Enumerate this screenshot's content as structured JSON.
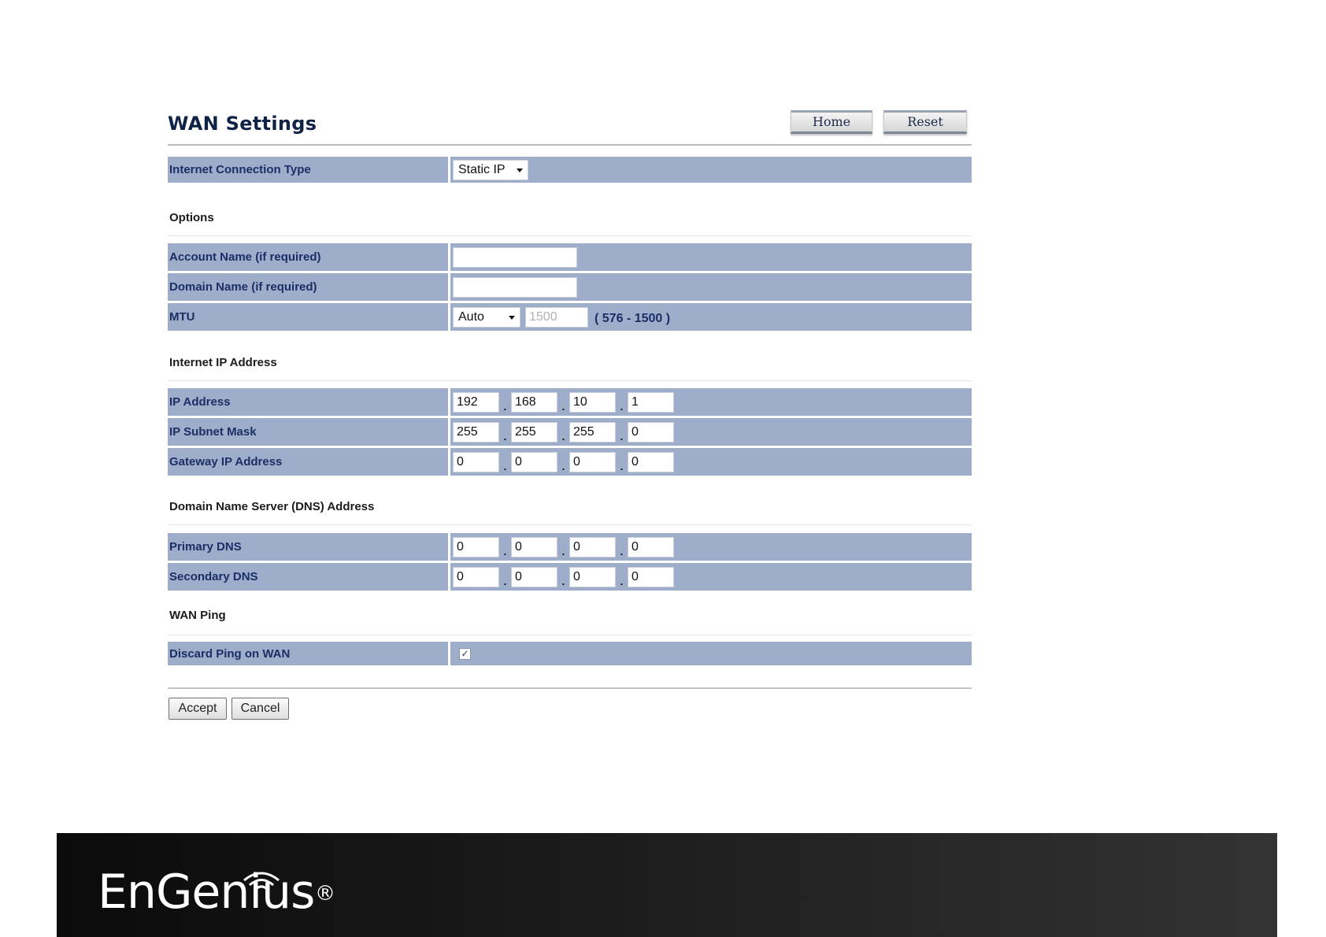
{
  "header": {
    "title": "WAN Settings",
    "home_label": "Home",
    "reset_label": "Reset"
  },
  "connection": {
    "label": "Internet Connection Type",
    "value": "Static IP"
  },
  "options": {
    "heading": "Options",
    "account_label": "Account Name (if required)",
    "account_value": "",
    "domain_label": "Domain Name (if required)",
    "domain_value": "",
    "mtu_label": "MTU",
    "mtu_mode": "Auto",
    "mtu_value": "1500",
    "mtu_range": "( 576 - 1500 )"
  },
  "internet_ip": {
    "heading": "Internet IP Address",
    "ip_label": "IP Address",
    "ip": [
      "192",
      "168",
      "10",
      "1"
    ],
    "mask_label": "IP Subnet Mask",
    "mask": [
      "255",
      "255",
      "255",
      "0"
    ],
    "gateway_label": "Gateway IP Address",
    "gateway": [
      "0",
      "0",
      "0",
      "0"
    ]
  },
  "dns": {
    "heading": "Domain Name Server (DNS) Address",
    "primary_label": "Primary DNS",
    "primary": [
      "0",
      "0",
      "0",
      "0"
    ],
    "secondary_label": "Secondary DNS",
    "secondary": [
      "0",
      "0",
      "0",
      "0"
    ]
  },
  "wan_ping": {
    "heading": "WAN Ping",
    "discard_label": "Discard Ping on WAN",
    "discard_checked": "✓"
  },
  "actions": {
    "accept_label": "Accept",
    "cancel_label": "Cancel"
  },
  "footer": {
    "brand": "EnGenius",
    "registered": "®"
  },
  "colors": {
    "row_bg": "#9eadc9",
    "label_text": "#1b2e66",
    "footer_bg": "#1a1a1a"
  }
}
